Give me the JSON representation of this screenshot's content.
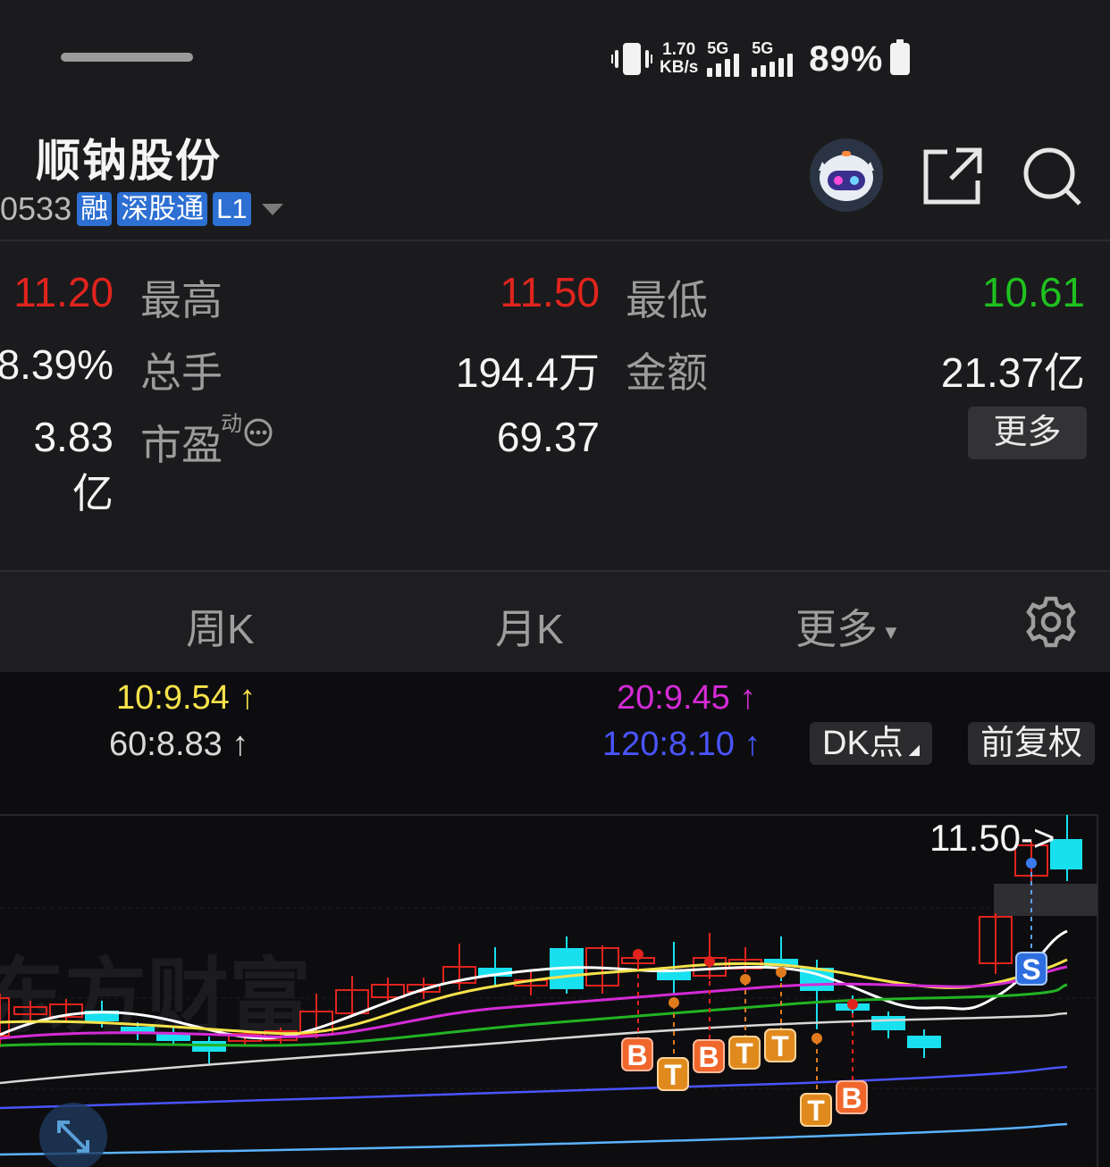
{
  "status_bar": {
    "speed_value": "1.70",
    "speed_unit": "KB/s",
    "sim1": "5G",
    "sim2": "5G",
    "battery": "89%"
  },
  "header": {
    "title": "顺钠股份",
    "code": "0533",
    "tags": [
      "融",
      "深股通",
      "L1"
    ]
  },
  "quote": {
    "r1": {
      "v1": "11.20",
      "l1": "最高",
      "v2": "11.50",
      "l2": "最低",
      "v3": "10.61"
    },
    "r2": {
      "v1": "8.39%",
      "l1": "总手",
      "v2": "194.4万",
      "l2": "金额",
      "v3": "21.37亿"
    },
    "r3": {
      "v1": "3.83亿",
      "l1": "市盈",
      "sup": "动",
      "v2": "69.37"
    },
    "more": "更多"
  },
  "tabs": {
    "week": "周K",
    "month": "月K",
    "more": "更多"
  },
  "ma_legend": {
    "ma10": "10:9.54 ↑",
    "ma20": "20:9.45 ↑",
    "ma60": "60:8.83 ↑",
    "ma120": "120:8.10 ↑",
    "dk_button": "DK点",
    "adjust_button": "前复权"
  },
  "chart": {
    "price_marker": "11.50->",
    "markers": {
      "b": "B",
      "t": "T",
      "s": "S"
    },
    "watermark": "东方财富"
  },
  "colors": {
    "up": "#e0241d",
    "down": "#19e0ee",
    "ma5": "#ffffff",
    "ma10": "#f7e34b",
    "ma20": "#d42bd6",
    "ma30": "#23b324",
    "ma60": "#d8d8d8",
    "ma120": "#4a54ff",
    "ma250": "#5ab3ff"
  }
}
